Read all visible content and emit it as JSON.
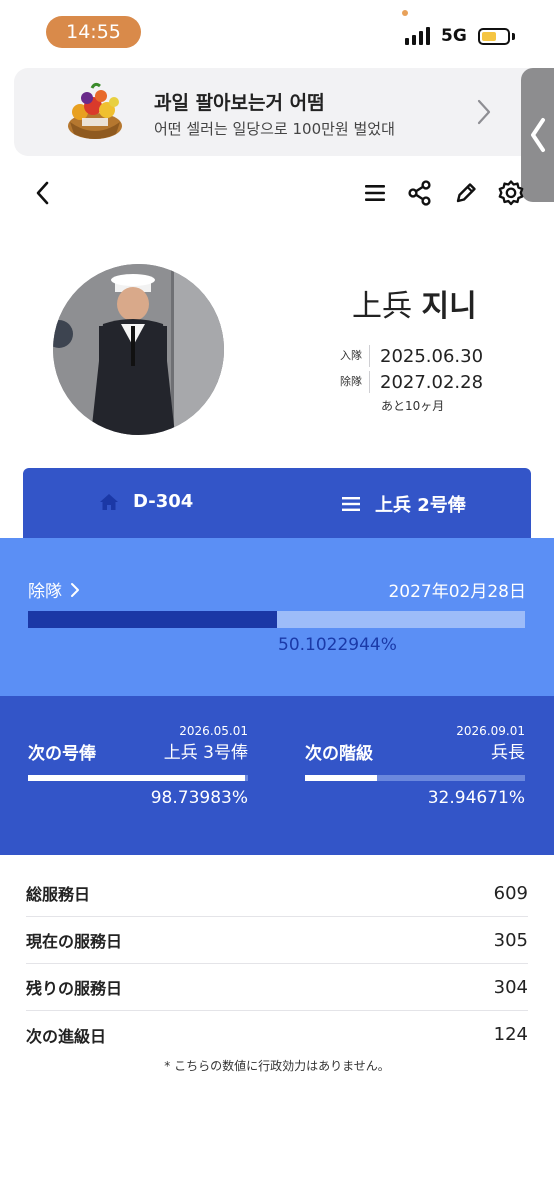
{
  "status_bar": {
    "time": "14:55",
    "network": "5G",
    "battery_level": 0.6
  },
  "ad": {
    "title": "과일 팔아보는거 어떰",
    "subtitle": "어떤 셀러는 일당으로 100만원 벌었대",
    "image_icon": "fruit-basket-icon"
  },
  "toolbar": {
    "back_icon": "chevron-left-icon",
    "icons": [
      "menu-icon",
      "share-icon",
      "edit-icon",
      "settings-icon"
    ]
  },
  "profile": {
    "rank": "上兵",
    "name": "지니",
    "enlist_label": "入隊",
    "enlist_date": "2025.06.30",
    "discharge_label": "除隊",
    "discharge_date": "2027.02.28",
    "remaining": "あと10ヶ月"
  },
  "tabs": {
    "dday": "D-304",
    "salary_rank": "上兵 2号俸"
  },
  "discharge": {
    "label": "除隊",
    "date": "2027年02月28日",
    "percent_text": "50.1022944%",
    "progress": 0.501022944
  },
  "next_step": {
    "title": "次の号俸",
    "date": "2026.05.01",
    "value": "上兵 3号俸",
    "percent_text": "98.73983%",
    "progress": 0.9873983
  },
  "next_rank": {
    "title": "次の階級",
    "date": "2026.09.01",
    "value": "兵長",
    "percent_text": "32.94671%",
    "progress": 0.3294671
  },
  "stats": [
    {
      "label": "総服務日",
      "value": "609"
    },
    {
      "label": "現在の服務日",
      "value": "305"
    },
    {
      "label": "残りの服務日",
      "value": "304"
    },
    {
      "label": "次の進級日",
      "value": "124"
    }
  ],
  "footnote": "* こちらの数値に行政効力はありません。",
  "colors": {
    "primary": "#3355c8",
    "light_blue": "#5b8ff5",
    "dark_blue": "#1b38a6",
    "time_pill": "#d98a4a"
  }
}
